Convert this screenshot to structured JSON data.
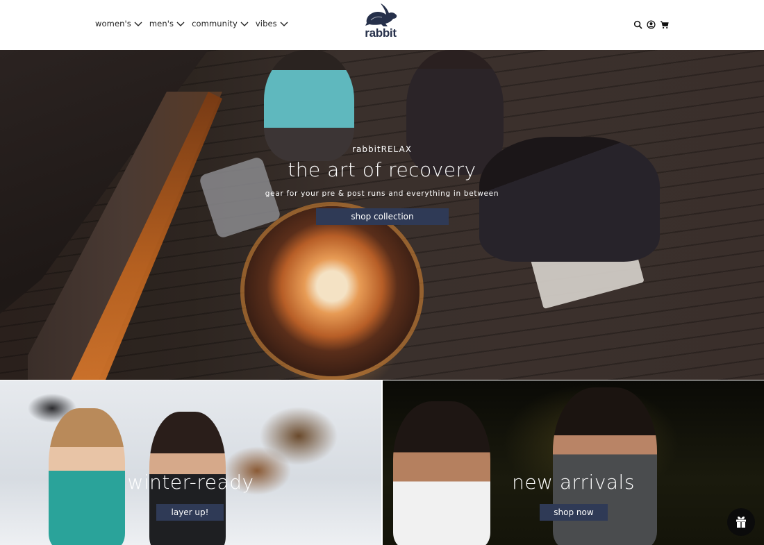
{
  "header": {
    "nav": [
      {
        "label": "women's",
        "icon": "chevron-down-icon"
      },
      {
        "label": "men's",
        "icon": "chevron-down-icon"
      },
      {
        "label": "community",
        "icon": "chevron-down-icon"
      },
      {
        "label": "vibes",
        "icon": "chevron-down-icon"
      }
    ],
    "logo_text": "rabbit",
    "utility_icons": [
      "search-icon",
      "account-icon",
      "cart-icon"
    ]
  },
  "hero": {
    "eyebrow": "rabbitRELAX",
    "headline": "the art of recovery",
    "subheadline": "gear for your pre & post runs and everything in between",
    "button_label": "shop collection"
  },
  "tiles": [
    {
      "title": "winter-ready",
      "button_label": "layer up!"
    },
    {
      "title": "new arrivals",
      "button_label": "shop now"
    }
  ],
  "floating": {
    "icon": "gift-icon"
  },
  "colors": {
    "brand_navy": "#2f3a56",
    "logo_navy": "#26304a",
    "text": "#222222"
  }
}
